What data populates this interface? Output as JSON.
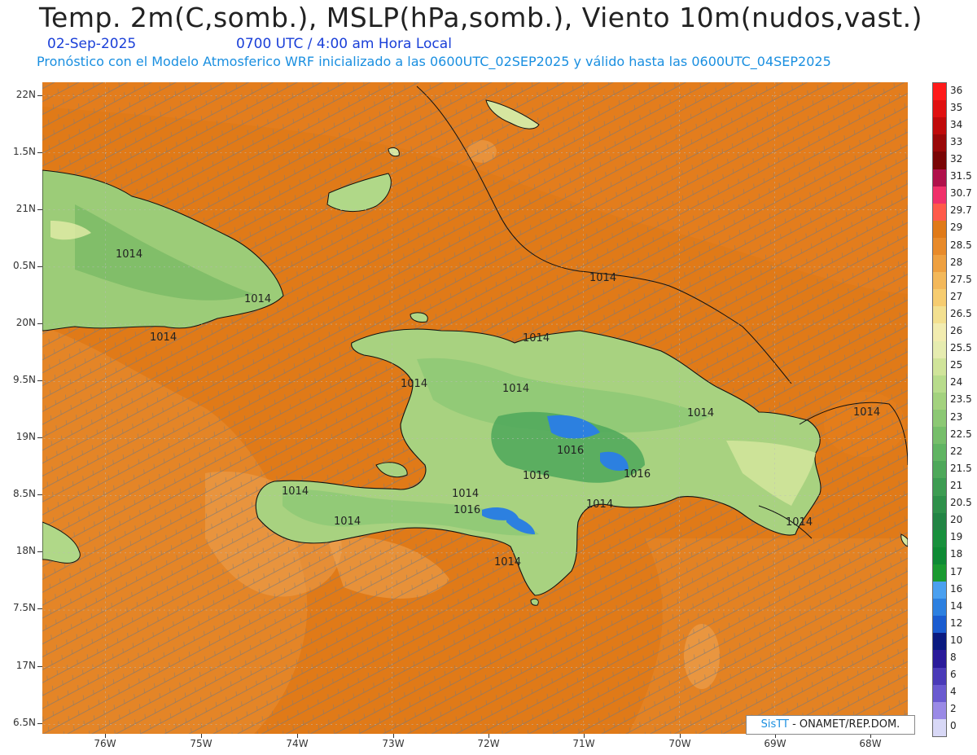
{
  "header": {
    "title": "Temp. 2m(C,somb.), MSLP(hPa,somb.), Viento 10m(nudos,vast.)",
    "date": "02-Sep-2025",
    "time": "0700 UTC / 4:00 am Hora Local",
    "model_info": "Pronóstico con el Modelo Atmosferico WRF inicializado a las 0600UTC_02SEP2025 y válido hasta las  0600UTC_04SEP2025"
  },
  "axes": {
    "lat_labels": [
      "22N",
      "1.5N",
      "21N",
      "0.5N",
      "20N",
      "9.5N",
      "19N",
      "8.5N",
      "18N",
      "7.5N",
      "17N",
      "6.5N"
    ],
    "lon_labels": [
      "76W",
      "75W",
      "74W",
      "73W",
      "72W",
      "71W",
      "70W",
      "69W",
      "68W"
    ]
  },
  "isobar_labels": [
    "1014",
    "1014",
    "1014",
    "1014",
    "1014",
    "1014",
    "1014",
    "1014",
    "1014",
    "1016",
    "1016",
    "1016",
    "1016",
    "1014",
    "1014",
    "1014",
    "1014",
    "1014",
    "1014"
  ],
  "colorbar": {
    "labels": [
      "36",
      "35",
      "34",
      "33",
      "32",
      "31.5",
      "30.7",
      "29.7",
      "29",
      "28.5",
      "28",
      "27.5",
      "27",
      "26.5",
      "26",
      "25.5",
      "25",
      "24",
      "23.5",
      "23",
      "22.5",
      "22",
      "21.5",
      "21",
      "20.5",
      "20",
      "19",
      "18",
      "17",
      "16",
      "14",
      "12",
      "10",
      "8",
      "6",
      "4",
      "2",
      "0"
    ],
    "colors": [
      "#ff1a1a",
      "#e01010",
      "#c00a0a",
      "#9a0808",
      "#7a0505",
      "#b0104a",
      "#f0306a",
      "#ff5a4a",
      "#e07a18",
      "#e88a2a",
      "#eea040",
      "#f3b85a",
      "#f6cc70",
      "#f3e090",
      "#f2ecb0",
      "#e6ecb0",
      "#d0e49a",
      "#b8dc8c",
      "#a3d27e",
      "#8cc874",
      "#76be6a",
      "#60b462",
      "#4ea85a",
      "#3d9c52",
      "#2e904a",
      "#228444",
      "#18903c",
      "#0e8a34",
      "#1a9a30",
      "#4aa0f0",
      "#2c80e0",
      "#1a5cd0",
      "#0a1a80",
      "#2a1a9a",
      "#4a3ab8",
      "#6a5ad0",
      "#9a8ae6",
      "#d8d8f6"
    ]
  },
  "credit": {
    "brand": "SisTT",
    "org": "- ONAMET/REP.DOM."
  }
}
